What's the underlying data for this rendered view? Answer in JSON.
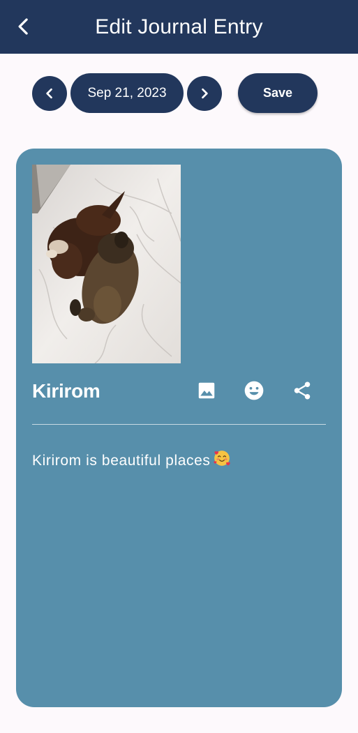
{
  "appbar": {
    "title": "Edit Journal Entry",
    "back_icon": "chevron-left-icon"
  },
  "date_nav": {
    "prev_icon": "chevron-left-icon",
    "date": "Sep 21, 2023",
    "next_icon": "chevron-right-icon"
  },
  "toolbar": {
    "save_label": "Save"
  },
  "entry": {
    "title": "Kirirom",
    "body": "Kirirom is beautiful places",
    "body_emoji": "smiling-face-with-hearts",
    "photo_subject": "two puppies on white bedsheet",
    "actions": [
      "image-icon",
      "emoji-icon",
      "share-icon"
    ]
  },
  "colors": {
    "primary": "#22375c",
    "card": "#578fab",
    "background": "#fdf9fc"
  }
}
